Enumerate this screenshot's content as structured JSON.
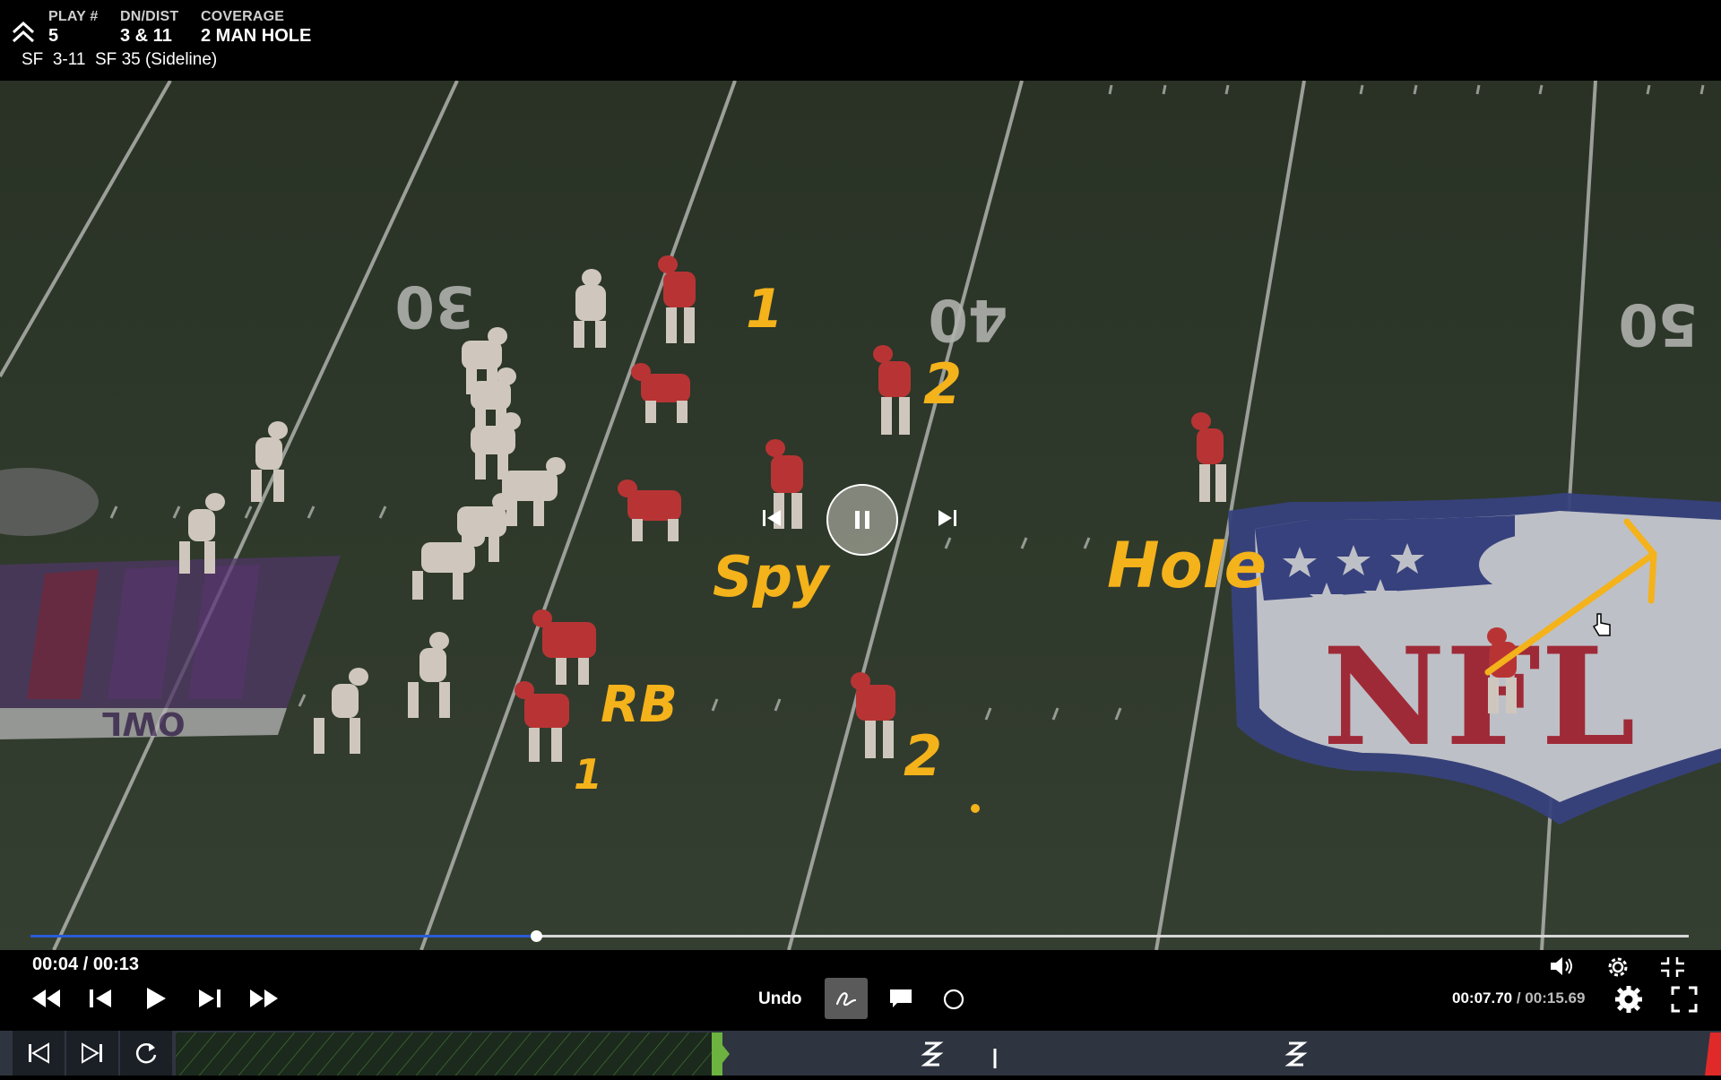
{
  "header": {
    "play_label": "PLAY #",
    "play_value": "5",
    "dndist_label": "DN/DIST",
    "dndist_value": "3 & 11",
    "coverage_label": "COVERAGE",
    "coverage_value": "2 MAN HOLE",
    "subline": "SF  3-11  SF 35 (Sideline)"
  },
  "field": {
    "yard_numbers": [
      "30",
      "40",
      "50"
    ],
    "annotations": [
      "1",
      "2",
      "Spy",
      "Hole",
      "RB",
      "1",
      "2"
    ],
    "logo_text": "NFL",
    "bowl_text": "OWL"
  },
  "player": {
    "clip_time": "00:04 / 00:13",
    "progress": 0.305,
    "undo_label": "Undo",
    "total_time_current": "00:07.70",
    "total_time_sep": " / ",
    "total_time_total": "00:15.69"
  },
  "icons": {
    "collapse": "chevron-up-double-icon",
    "rewind": "rewind-icon",
    "step_back": "step-back-icon",
    "play": "play-icon",
    "step_forward": "step-forward-icon",
    "fast_forward": "fast-forward-icon",
    "draw": "draw-icon",
    "comment": "comment-icon",
    "circle": "circle-icon",
    "volume": "volume-icon",
    "settings": "gear-icon",
    "exit_fullscreen": "exit-fullscreen-icon",
    "fullscreen": "fullscreen-icon",
    "prev_play": "previous-play-icon",
    "next_play": "next-play-icon",
    "replay": "replay-icon"
  },
  "colors": {
    "annotation": "#f4b21b",
    "progress": "#2a5bd7",
    "clip_active": "#6cb33f",
    "sf_jersey": "#f1e9df",
    "kc_jersey": "#d83a3a"
  }
}
